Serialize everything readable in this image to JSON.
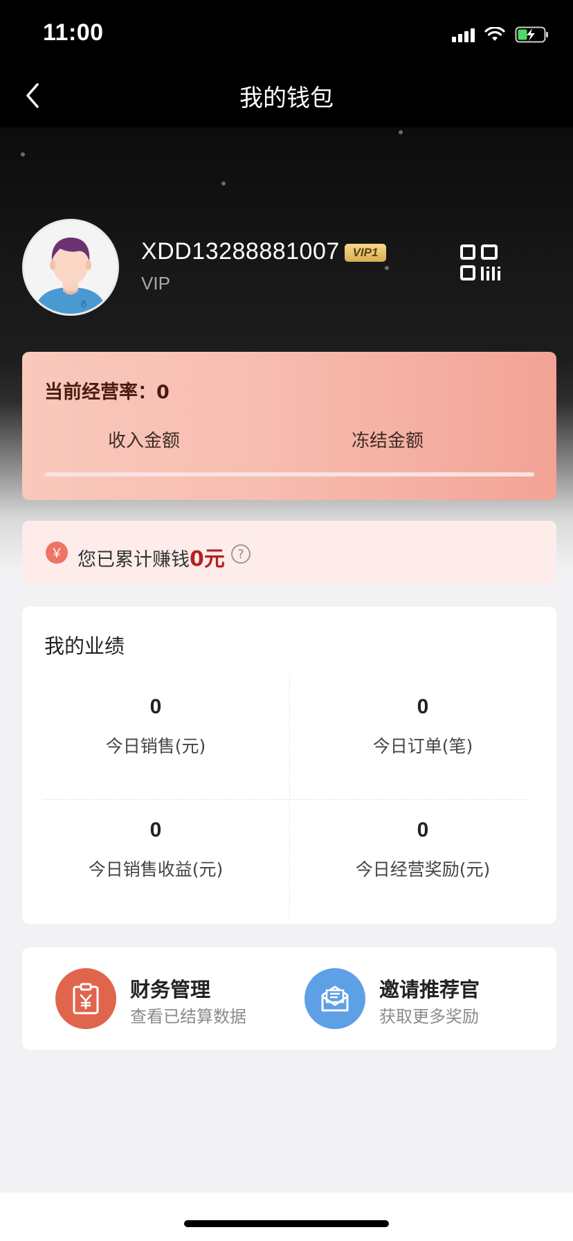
{
  "status": {
    "time": "11:00"
  },
  "nav": {
    "title": "我的钱包"
  },
  "profile": {
    "username": "XDD13288881007",
    "badge": "VIP1",
    "level": "VIP"
  },
  "rate_card": {
    "label": "当前经营率：",
    "value": "0",
    "income_label": "收入金额",
    "frozen_label": "冻结金额"
  },
  "earned": {
    "icon": "￥",
    "prefix": "您已累计赚钱",
    "amount": "0元",
    "help_icon": "?"
  },
  "performance": {
    "title": "我的业绩",
    "stats": [
      {
        "value": "0",
        "label": "今日销售(元)"
      },
      {
        "value": "0",
        "label": "今日订单(笔)"
      },
      {
        "value": "0",
        "label": "今日销售收益(元)"
      },
      {
        "value": "0",
        "label": "今日经营奖励(元)"
      }
    ]
  },
  "shortcuts": [
    {
      "title": "财务管理",
      "subtitle": "查看已结算数据",
      "icon": "clipboard-yen-icon",
      "color": "#e0654d"
    },
    {
      "title": "邀请推荐官",
      "subtitle": "获取更多奖励",
      "icon": "envelope-icon",
      "color": "#5ea0e6"
    }
  ],
  "colors": {
    "accent_red": "#b42020",
    "rate_card_start": "#f9c9bc",
    "rate_card_end": "#f2a396"
  }
}
